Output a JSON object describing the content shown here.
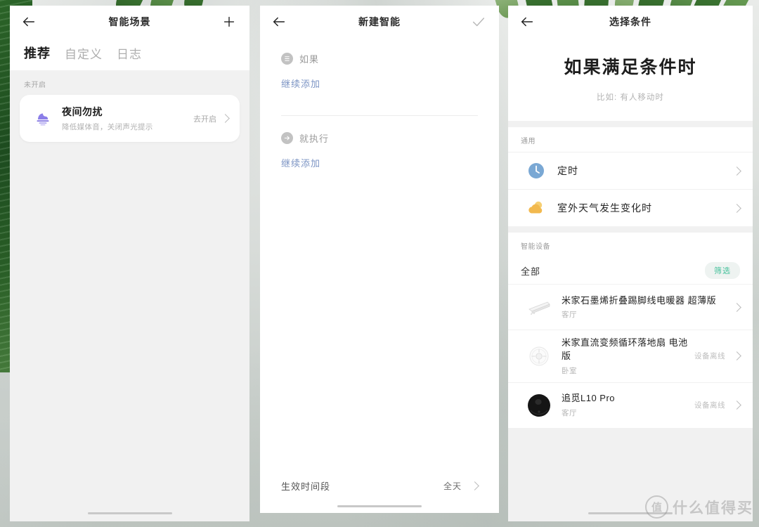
{
  "watermark": {
    "mark": "值",
    "text": "什么值得买"
  },
  "panel_left": {
    "header": {
      "back_icon": "back-arrow-icon",
      "title": "智能场景",
      "add_icon": "plus-icon"
    },
    "tabs": [
      {
        "label": "推荐",
        "active": true
      },
      {
        "label": "自定义",
        "active": false
      },
      {
        "label": "日志",
        "active": false
      }
    ],
    "group_label": "未开启",
    "card": {
      "icon": "do-not-disturb-moon-icon",
      "title": "夜间勿扰",
      "subtitle": "降低媒体音，关闭声光提示",
      "action": "去开启",
      "chevron": "chevron-right-icon"
    }
  },
  "panel_middle": {
    "header": {
      "back_icon": "back-arrow-icon",
      "title": "新建智能",
      "confirm_icon": "check-icon"
    },
    "if_section": {
      "icon": "condition-list-icon",
      "label": "如果",
      "add_link": "继续添加"
    },
    "then_section": {
      "icon": "action-arrow-icon",
      "label": "就执行",
      "add_link": "继续添加"
    },
    "footer": {
      "label": "生效时间段",
      "value": "全天",
      "chevron": "chevron-right-icon"
    }
  },
  "panel_right": {
    "header": {
      "back_icon": "back-arrow-icon",
      "title": "选择条件"
    },
    "hero": {
      "title": "如果满足条件时",
      "hint": "比如: 有人移动时"
    },
    "general": {
      "section_label": "通用",
      "items": [
        {
          "icon": "clock-icon",
          "label": "定时",
          "chevron": "chevron-right-icon"
        },
        {
          "icon": "weather-cloud-sun-icon",
          "label": "室外天气发生变化时",
          "chevron": "chevron-right-icon"
        }
      ]
    },
    "devices": {
      "section_label": "智能设备",
      "filter_row": {
        "label": "全部",
        "button": "筛选"
      },
      "items": [
        {
          "icon": "heater-icon",
          "name": "米家石墨烯折叠踢脚线电暖器 超薄版",
          "room": "客厅",
          "status": "",
          "chevron": "chevron-right-icon"
        },
        {
          "icon": "fan-icon",
          "name": "米家直流变频循环落地扇 电池版",
          "room": "卧室",
          "status": "设备离线",
          "chevron": "chevron-right-icon"
        },
        {
          "icon": "robot-vacuum-icon",
          "name": "追觅L10 Pro",
          "room": "客厅",
          "status": "设备离线",
          "chevron": "chevron-right-icon"
        }
      ]
    }
  },
  "colors": {
    "accent_blue_link": "#7c94c4",
    "accent_green_pill": "#43c09a",
    "moon_purple": "#8b7ee8",
    "clock_blue": "#7aa8d4",
    "weather_orange": "#f2bf5e"
  }
}
